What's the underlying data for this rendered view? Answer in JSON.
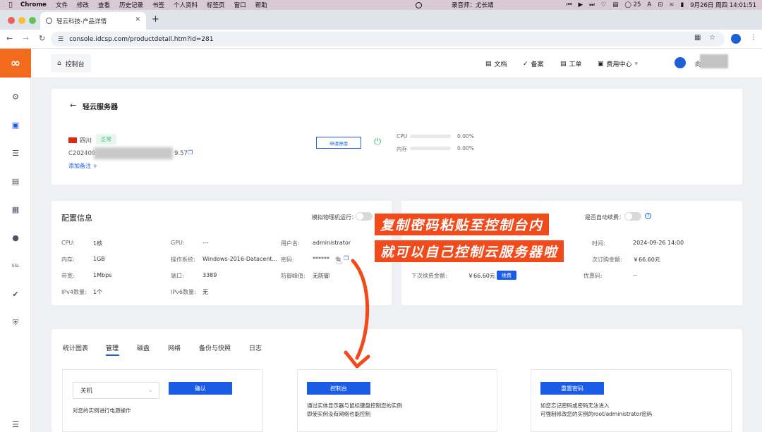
{
  "menubar": {
    "items": [
      "Chrome",
      "文件",
      "修改",
      "查看",
      "历史记录",
      "书签",
      "个人资料",
      "标签页",
      "窗口",
      "帮助"
    ],
    "recorder": "录音师：尤长靖",
    "battery": "25",
    "datetime": "9月26日 周四  14:01:51"
  },
  "browser": {
    "tab_title": "轻云科技-产品详情",
    "url": "console.idcsp.com/productdetail.htm?id=281"
  },
  "header": {
    "console_label": "控制台",
    "nav": [
      "文档",
      "备案",
      "工单",
      "费用中心"
    ],
    "user_name": "向"
  },
  "product": {
    "back_title": "轻云服务器",
    "region": "四川",
    "status": "正常",
    "instance_prefix": "C202409",
    "instance_suffix": "9.57",
    "add_note": "添加备注 +",
    "apply_stop": "申请停用",
    "cpu_label": "CPU",
    "cpu_value": "0.00%",
    "mem_label": "内存",
    "mem_value": "0.00%"
  },
  "config": {
    "title": "配置信息",
    "sim_label": "模拟物理机运行：",
    "rows": [
      {
        "k1": "CPU:",
        "v1": "1核",
        "k2": "GPU:",
        "v2": "---",
        "k3": "用户名:",
        "v3": "administrator"
      },
      {
        "k1": "内存:",
        "v1": "1GB",
        "k2": "操作系统:",
        "v2": "Windows-2016-Datacent...",
        "k3": "密码:",
        "v3": "******"
      },
      {
        "k1": "带宽:",
        "v1": "1Mbps",
        "k2": "端口:",
        "v2": "3389",
        "k3": "防御峰值:",
        "v3": "无防御"
      },
      {
        "k1": "IPv4数量:",
        "v1": "1个",
        "k2": "IPv6数量:",
        "v2": "无",
        "k3": "",
        "v3": ""
      }
    ]
  },
  "billing": {
    "auto_renew_label": "是否自动续费：",
    "time_label": "时间:",
    "time_value": "2024-09-26 14:00",
    "order_label": "次订购金额:",
    "order_value": "￥66.60元",
    "next_label": "下次续费金额:",
    "next_value": "￥66.60元",
    "renew_btn": "续费",
    "coupon_label": "优惠码:",
    "coupon_value": "--"
  },
  "overlay": {
    "line1": "复制密码粘贴至控制台内",
    "line2": "就可以自己控制云服务器啦"
  },
  "manage_tabs": [
    "统计图表",
    "管理",
    "磁盘",
    "网络",
    "备份与快照",
    "日志"
  ],
  "active_tab": "管理",
  "panels": {
    "power": {
      "select": "关机",
      "confirm": "确认",
      "desc": "对您的实例进行电源操作"
    },
    "console": {
      "btn": "控制台",
      "desc1": "通过实体显示器与鼠标键盘控制您的实例",
      "desc2": "即使实例没有网络也能控制"
    },
    "reset": {
      "btn": "重置密码",
      "desc1": "如您忘记密码或密码无法进入",
      "desc2": "可强制修改您的实例的root/administrator密码"
    }
  }
}
